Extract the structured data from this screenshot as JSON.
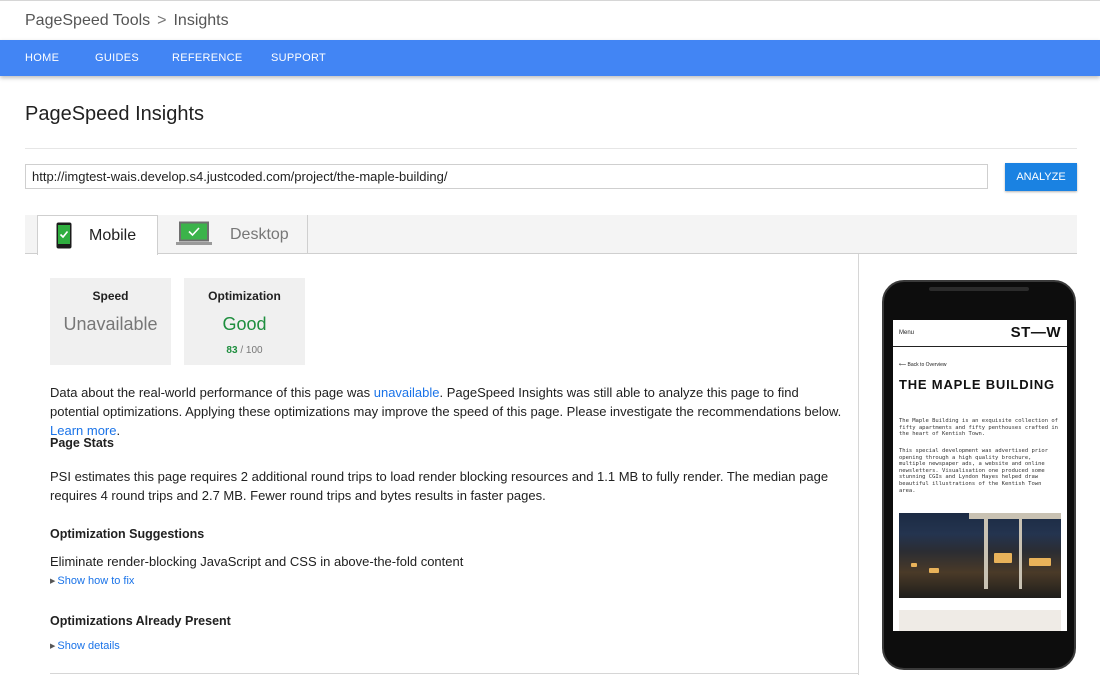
{
  "breadcrumb": {
    "root": "PageSpeed Tools",
    "separator": ">",
    "current": "Insights"
  },
  "nav": {
    "items": [
      "HOME",
      "GUIDES",
      "REFERENCE",
      "SUPPORT"
    ],
    "color": "#4285f4"
  },
  "page": {
    "title": "PageSpeed Insights"
  },
  "url_bar": {
    "value": "http://imgtest-wais.develop.s4.justcoded.com/project/the-maple-building/",
    "button_label": "ANALYZE"
  },
  "tabs": [
    {
      "label": "Mobile",
      "icon": "mobile-phone-check-icon",
      "selected": true
    },
    {
      "label": "Desktop",
      "icon": "desktop-monitor-check-icon",
      "selected": false
    }
  ],
  "cards": {
    "speed": {
      "title": "Speed",
      "value": "Unavailable"
    },
    "optimization": {
      "title": "Optimization",
      "value": "Good",
      "score": "83",
      "score_max": "/ 100"
    }
  },
  "intro": {
    "part1": "Data about the real-world performance of this page was ",
    "link1": "unavailable",
    "part2": ". PageSpeed Insights was still able to analyze this page to find potential optimizations. Applying these optimizations may improve the speed of this page. Please investigate the recommendations below. ",
    "link2": "Learn more",
    "part3": "."
  },
  "page_stats": {
    "heading": "Page Stats",
    "text": "PSI estimates this page requires 2 additional round trips to load render blocking resources and 1.1 MB to fully render. The median page requires 4 round trips and 2.7 MB. Fewer round trips and bytes results in faster pages."
  },
  "suggestions": {
    "heading": "Optimization Suggestions",
    "item": "Eliminate render-blocking JavaScript and CSS in above-the-fold content",
    "toggle": "Show how to fix"
  },
  "present": {
    "heading": "Optimizations Already Present",
    "toggle": "Show details"
  },
  "preview": {
    "menu": "Menu",
    "logo": "ST—W",
    "back": "⟵  Back to Overview",
    "title": "THE MAPLE BUILDING",
    "p1": "The Maple Building is an exquisite collection of fifty apartments and fifty penthouses crafted in the heart of Kentish Town.",
    "p2": "This special development was advertised prior opening through a high quality brochure, multiple newspaper ads, a website and online newsletters. Visualisation one produced some stunning CGIs and Lyndon Hayes helped draw beautiful illustrations of the Kentish Town area."
  },
  "colors": {
    "accent": "#1a82e2",
    "good": "#1e8e3e",
    "link": "#1a73e8"
  }
}
